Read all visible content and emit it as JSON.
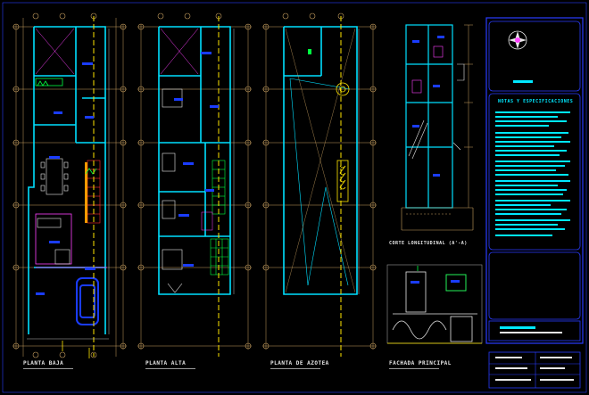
{
  "drawing": {
    "background": "#000000",
    "colors": {
      "wall": "#00e0ff",
      "grid": "#c8a060",
      "axis_yellow": "#ffe600",
      "blue_label": "#1a3cff",
      "green": "#00ff40",
      "magenta": "#ff40ff",
      "red": "#ff3030",
      "white": "#e8e8e8",
      "gray": "#8a8a8a",
      "sheet_border": "#2a3cff"
    },
    "plans": [
      {
        "id": "planta-baja",
        "title": "PLANTA BAJA"
      },
      {
        "id": "planta-alta",
        "title": "PLANTA ALTA"
      },
      {
        "id": "planta-azotea",
        "title": "PLANTA DE AZOTEA"
      }
    ],
    "sections": {
      "longitudinal_title": "CORTE LONGITUDINAL  (A'-A)",
      "facade_title": "FACHADA PRINCIPAL"
    },
    "title_block": {
      "heading": "NOTAS Y ESPECIFICACIONES",
      "north_icon": "north-arrow-icon"
    }
  }
}
